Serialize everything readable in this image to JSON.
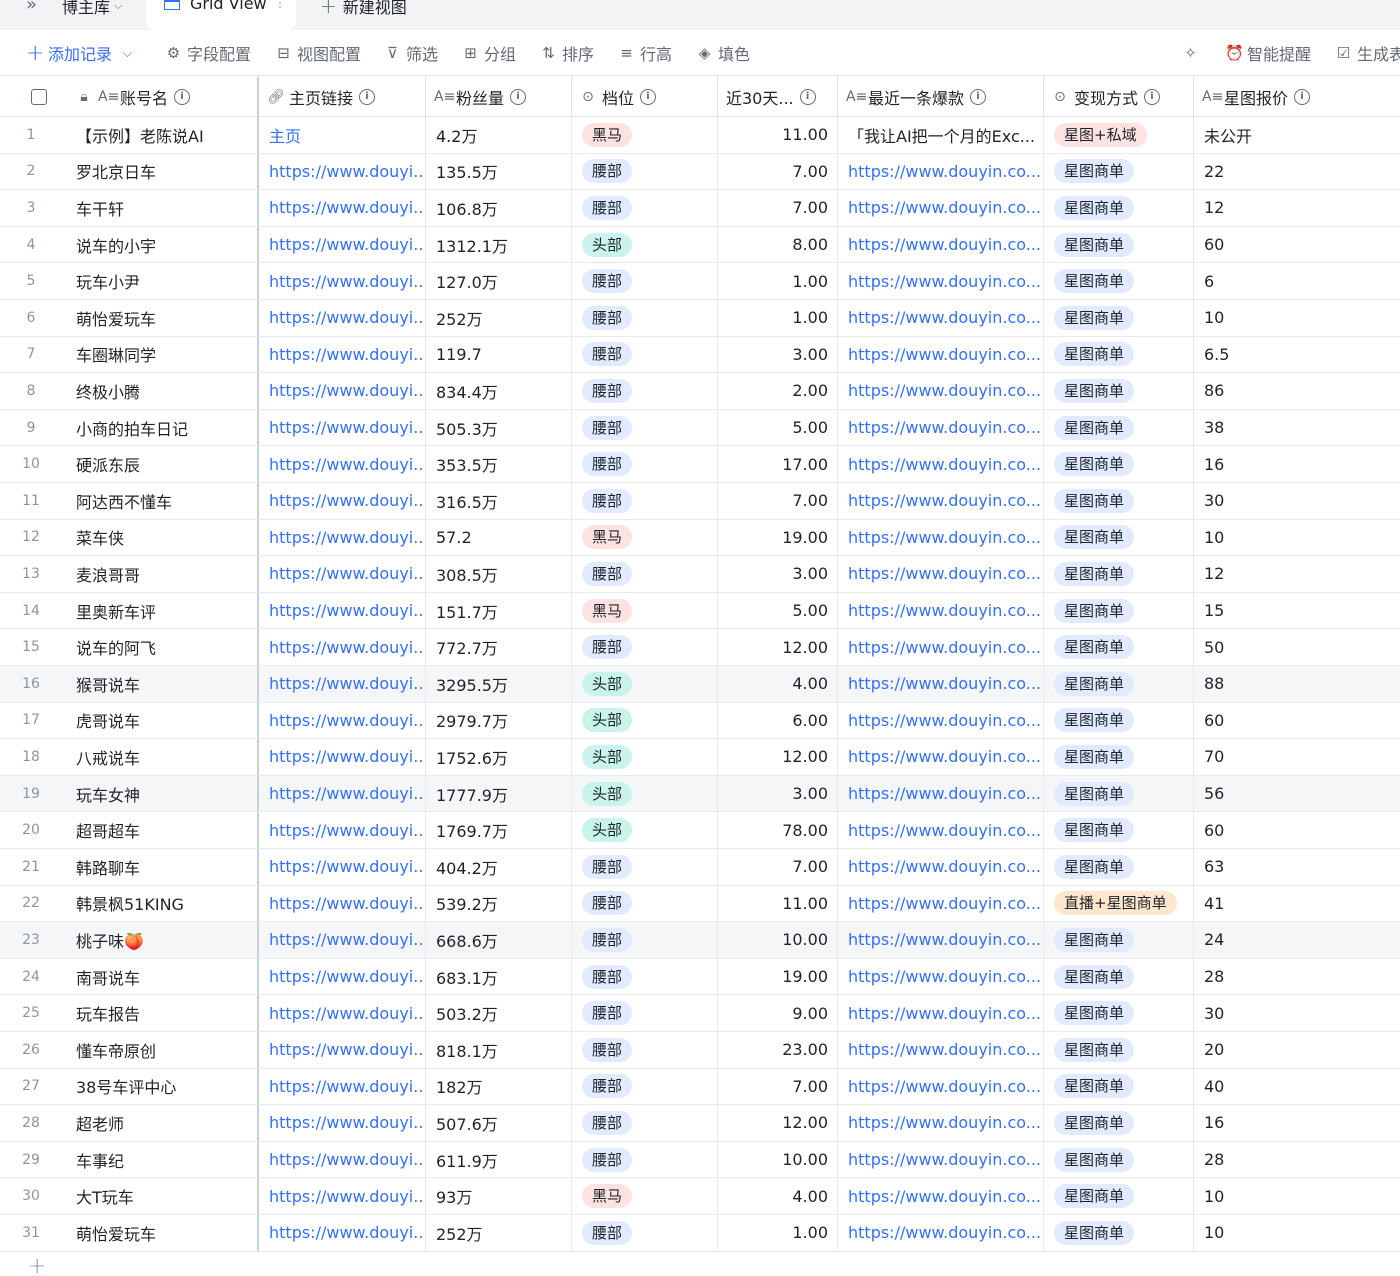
{
  "tabbar": {
    "collapse_icon": "double-chevron-right-icon",
    "db_name": "博主库",
    "active_view": "Grid View",
    "more_icon": "⋮",
    "new_view": "新建视图"
  },
  "toolbar": {
    "add_record": "添加记录",
    "field_config": "字段配置",
    "view_config": "视图配置",
    "filter": "筛选",
    "group": "分组",
    "sort": "排序",
    "row_height": "行高",
    "fill_color": "填色",
    "smart_reminder": "智能提醒",
    "generate": "生成表"
  },
  "columns": {
    "name": "账号名",
    "link": "主页链接",
    "fans": "粉丝量",
    "tier": "档位",
    "recent30": "近30天...",
    "hit": "最近一条爆款",
    "monetize": "变现方式",
    "price": "星图报价"
  },
  "colors": {
    "accent": "#3370ff",
    "tag_waist": "#e1eaff",
    "tag_head": "#c8f4ec",
    "tag_darkhorse": "#fde2e2",
    "tag_live": "#fee7cd"
  },
  "rows": [
    {
      "idx": "1",
      "name": "【示例】老陈说AI",
      "link": "主页",
      "fans": "4.2万",
      "tier": "黑马",
      "recent30": "11.00",
      "hit": "「我让AI把一个月的Exc...",
      "monetize": "星图+私域",
      "price": "未公开"
    },
    {
      "idx": "2",
      "name": "罗北京日车",
      "link": "https://www.douyi...",
      "fans": "135.5万",
      "tier": "腰部",
      "recent30": "7.00",
      "hit": "https://www.douyin.co...",
      "monetize": "星图商单",
      "price": "22"
    },
    {
      "idx": "3",
      "name": "车干轩",
      "link": "https://www.douyi...",
      "fans": "106.8万",
      "tier": "腰部",
      "recent30": "7.00",
      "hit": "https://www.douyin.co...",
      "monetize": "星图商单",
      "price": "12"
    },
    {
      "idx": "4",
      "name": "说车的小宇",
      "link": "https://www.douyi...",
      "fans": "1312.1万",
      "tier": "头部",
      "recent30": "8.00",
      "hit": "https://www.douyin.co...",
      "monetize": "星图商单",
      "price": "60"
    },
    {
      "idx": "5",
      "name": "玩车小尹",
      "link": "https://www.douyi...",
      "fans": "127.0万",
      "tier": "腰部",
      "recent30": "1.00",
      "hit": "https://www.douyin.co...",
      "monetize": "星图商单",
      "price": "6"
    },
    {
      "idx": "6",
      "name": "萌怡爱玩车",
      "link": "https://www.douyi...",
      "fans": "252万",
      "tier": "腰部",
      "recent30": "1.00",
      "hit": "https://www.douyin.co...",
      "monetize": "星图商单",
      "price": "10"
    },
    {
      "idx": "7",
      "name": "车圈琳同学",
      "link": "https://www.douyi...",
      "fans": "119.7",
      "tier": "腰部",
      "recent30": "3.00",
      "hit": "https://www.douyin.co...",
      "monetize": "星图商单",
      "price": "6.5"
    },
    {
      "idx": "8",
      "name": "终极小腾",
      "link": "https://www.douyi...",
      "fans": "834.4万",
      "tier": "腰部",
      "recent30": "2.00",
      "hit": "https://www.douyin.co...",
      "monetize": "星图商单",
      "price": "86"
    },
    {
      "idx": "9",
      "name": "小商的拍车日记",
      "link": "https://www.douyi...",
      "fans": "505.3万",
      "tier": "腰部",
      "recent30": "5.00",
      "hit": "https://www.douyin.co...",
      "monetize": "星图商单",
      "price": "38"
    },
    {
      "idx": "10",
      "name": "硬派东辰",
      "link": "https://www.douyi...",
      "fans": "353.5万",
      "tier": "腰部",
      "recent30": "17.00",
      "hit": "https://www.douyin.co...",
      "monetize": "星图商单",
      "price": "16"
    },
    {
      "idx": "11",
      "name": "阿达西不懂车",
      "link": "https://www.douyi...",
      "fans": "316.5万",
      "tier": "腰部",
      "recent30": "7.00",
      "hit": "https://www.douyin.co...",
      "monetize": "星图商单",
      "price": "30"
    },
    {
      "idx": "12",
      "name": "菜车侠",
      "link": "https://www.douyi...",
      "fans": "57.2",
      "tier": "黑马",
      "recent30": "19.00",
      "hit": "https://www.douyin.co...",
      "monetize": "星图商单",
      "price": "10"
    },
    {
      "idx": "13",
      "name": "麦浪哥哥",
      "link": "https://www.douyi...",
      "fans": "308.5万",
      "tier": "腰部",
      "recent30": "3.00",
      "hit": "https://www.douyin.co...",
      "monetize": "星图商单",
      "price": "12"
    },
    {
      "idx": "14",
      "name": "里奥新车评",
      "link": "https://www.douyi...",
      "fans": "151.7万",
      "tier": "黑马",
      "recent30": "5.00",
      "hit": "https://www.douyin.co...",
      "monetize": "星图商单",
      "price": "15"
    },
    {
      "idx": "15",
      "name": "说车的阿飞",
      "link": "https://www.douyi...",
      "fans": "772.7万",
      "tier": "腰部",
      "recent30": "12.00",
      "hit": "https://www.douyin.co...",
      "monetize": "星图商单",
      "price": "50"
    },
    {
      "idx": "16",
      "name": "猴哥说车",
      "link": "https://www.douyi...",
      "fans": "3295.5万",
      "tier": "头部",
      "recent30": "4.00",
      "hit": "https://www.douyin.co...",
      "monetize": "星图商单",
      "price": "88"
    },
    {
      "idx": "17",
      "name": "虎哥说车",
      "link": "https://www.douyi...",
      "fans": "2979.7万",
      "tier": "头部",
      "recent30": "6.00",
      "hit": "https://www.douyin.co...",
      "monetize": "星图商单",
      "price": "60"
    },
    {
      "idx": "18",
      "name": "八戒说车",
      "link": "https://www.douyi...",
      "fans": "1752.6万",
      "tier": "头部",
      "recent30": "12.00",
      "hit": "https://www.douyin.co...",
      "monetize": "星图商单",
      "price": "70"
    },
    {
      "idx": "19",
      "name": "玩车女神",
      "link": "https://www.douyi...",
      "fans": "1777.9万",
      "tier": "头部",
      "recent30": "3.00",
      "hit": "https://www.douyin.co...",
      "monetize": "星图商单",
      "price": "56"
    },
    {
      "idx": "20",
      "name": "超哥超车",
      "link": "https://www.douyi...",
      "fans": "1769.7万",
      "tier": "头部",
      "recent30": "78.00",
      "hit": "https://www.douyin.co...",
      "monetize": "星图商单",
      "price": "60"
    },
    {
      "idx": "21",
      "name": "韩路聊车",
      "link": "https://www.douyi...",
      "fans": "404.2万",
      "tier": "腰部",
      "recent30": "7.00",
      "hit": "https://www.douyin.co...",
      "monetize": "星图商单",
      "price": "63"
    },
    {
      "idx": "22",
      "name": "韩景枫51KING",
      "link": "https://www.douyi...",
      "fans": "539.2万",
      "tier": "腰部",
      "recent30": "11.00",
      "hit": "https://www.douyin.co...",
      "monetize": "直播+星图商单",
      "price": "41"
    },
    {
      "idx": "23",
      "name": "桃子味🍑",
      "link": "https://www.douyi...",
      "fans": "668.6万",
      "tier": "腰部",
      "recent30": "10.00",
      "hit": "https://www.douyin.co...",
      "monetize": "星图商单",
      "price": "24"
    },
    {
      "idx": "24",
      "name": "南哥说车",
      "link": "https://www.douyi...",
      "fans": "683.1万",
      "tier": "腰部",
      "recent30": "19.00",
      "hit": "https://www.douyin.co...",
      "monetize": "星图商单",
      "price": "28"
    },
    {
      "idx": "25",
      "name": "玩车报告",
      "link": "https://www.douyi...",
      "fans": "503.2万",
      "tier": "腰部",
      "recent30": "9.00",
      "hit": "https://www.douyin.co...",
      "monetize": "星图商单",
      "price": "30"
    },
    {
      "idx": "26",
      "name": "懂车帝原创",
      "link": "https://www.douyi...",
      "fans": "818.1万",
      "tier": "腰部",
      "recent30": "23.00",
      "hit": "https://www.douyin.co...",
      "monetize": "星图商单",
      "price": "20"
    },
    {
      "idx": "27",
      "name": "38号车评中心",
      "link": "https://www.douyi...",
      "fans": "182万",
      "tier": "腰部",
      "recent30": "7.00",
      "hit": "https://www.douyin.co...",
      "monetize": "星图商单",
      "price": "40"
    },
    {
      "idx": "28",
      "name": "超老师",
      "link": "https://www.douyi...",
      "fans": "507.6万",
      "tier": "腰部",
      "recent30": "12.00",
      "hit": "https://www.douyin.co...",
      "monetize": "星图商单",
      "price": "16"
    },
    {
      "idx": "29",
      "name": "车事纪",
      "link": "https://www.douyi...",
      "fans": "611.9万",
      "tier": "腰部",
      "recent30": "10.00",
      "hit": "https://www.douyin.co...",
      "monetize": "星图商单",
      "price": "28"
    },
    {
      "idx": "30",
      "name": "大T玩车",
      "link": "https://www.douyi...",
      "fans": "93万",
      "tier": "黑马",
      "recent30": "4.00",
      "hit": "https://www.douyin.co...",
      "monetize": "星图商单",
      "price": "10"
    },
    {
      "idx": "31",
      "name": "萌怡爱玩车",
      "link": "https://www.douyi...",
      "fans": "252万",
      "tier": "腰部",
      "recent30": "1.00",
      "hit": "https://www.douyin.co...",
      "monetize": "星图商单",
      "price": "10"
    }
  ]
}
